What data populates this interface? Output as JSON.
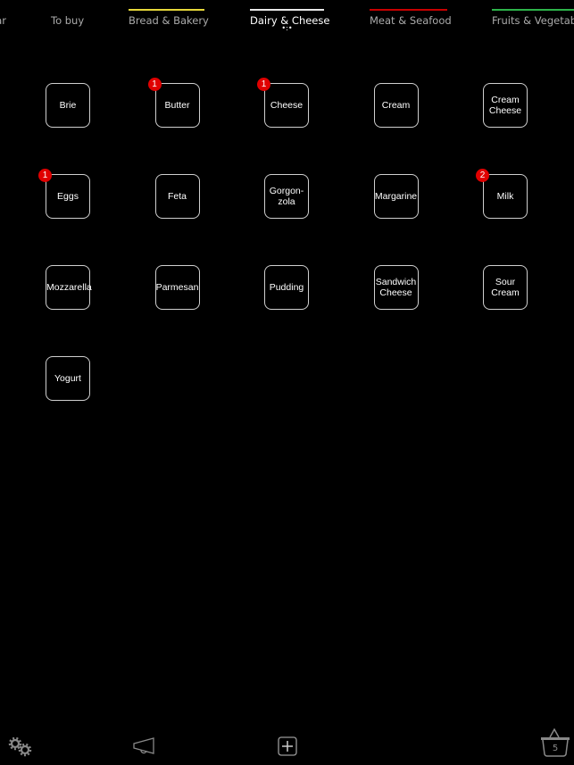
{
  "tabs": [
    {
      "label": "ar",
      "color": null,
      "active": false
    },
    {
      "label": "To buy",
      "color": null,
      "active": false
    },
    {
      "label": "Bread & Bakery",
      "color": "#e6d83a",
      "active": false
    },
    {
      "label": "Dairy & Cheese",
      "color": "#e8e8e8",
      "active": true
    },
    {
      "label": "Meat & Seafood",
      "color": "#c80000",
      "active": false
    },
    {
      "label": "Fruits & Vegetab",
      "color": "#2db34a",
      "active": false
    }
  ],
  "items": [
    {
      "label": "Brie",
      "badge": null
    },
    {
      "label": "Butter",
      "badge": "1"
    },
    {
      "label": "Cheese",
      "badge": "1"
    },
    {
      "label": "Cream",
      "badge": null
    },
    {
      "label": "Cream Cheese",
      "badge": null
    },
    {
      "label": "Eggs",
      "badge": "1"
    },
    {
      "label": "Feta",
      "badge": null
    },
    {
      "label": "Gorgon-zola",
      "badge": null
    },
    {
      "label": "Margarine",
      "badge": null
    },
    {
      "label": "Milk",
      "badge": "2"
    },
    {
      "label": "Mozzarella",
      "badge": null
    },
    {
      "label": "Parmesan",
      "badge": null
    },
    {
      "label": "Pudding",
      "badge": null
    },
    {
      "label": "Sandwich Cheese",
      "badge": null
    },
    {
      "label": "Sour Cream",
      "badge": null
    },
    {
      "label": "Yogurt",
      "badge": null
    }
  ],
  "toolbar": {
    "basket_count": "5",
    "icons": [
      "gears-icon",
      "megaphone-icon",
      "add-icon",
      "basket-icon"
    ]
  },
  "colors": {
    "badge": "#e00000",
    "background": "#000000"
  }
}
